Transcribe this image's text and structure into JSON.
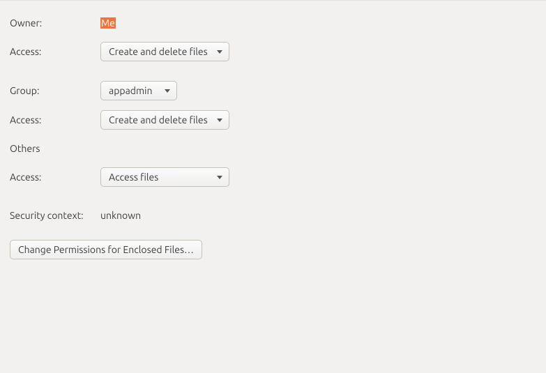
{
  "labels": {
    "owner": "Owner:",
    "access_owner": "Access:",
    "group": "Group:",
    "access_group": "Access:",
    "others": "Others",
    "access_others": "Access:",
    "security_context": "Security context:"
  },
  "values": {
    "owner": "Me",
    "access_owner": "Create and delete files",
    "group": "appadmin",
    "access_group": "Create and delete files",
    "access_others": "Access files",
    "security_context": "unknown"
  },
  "buttons": {
    "change_enclosed": "Change Permissions for Enclosed Files…"
  }
}
